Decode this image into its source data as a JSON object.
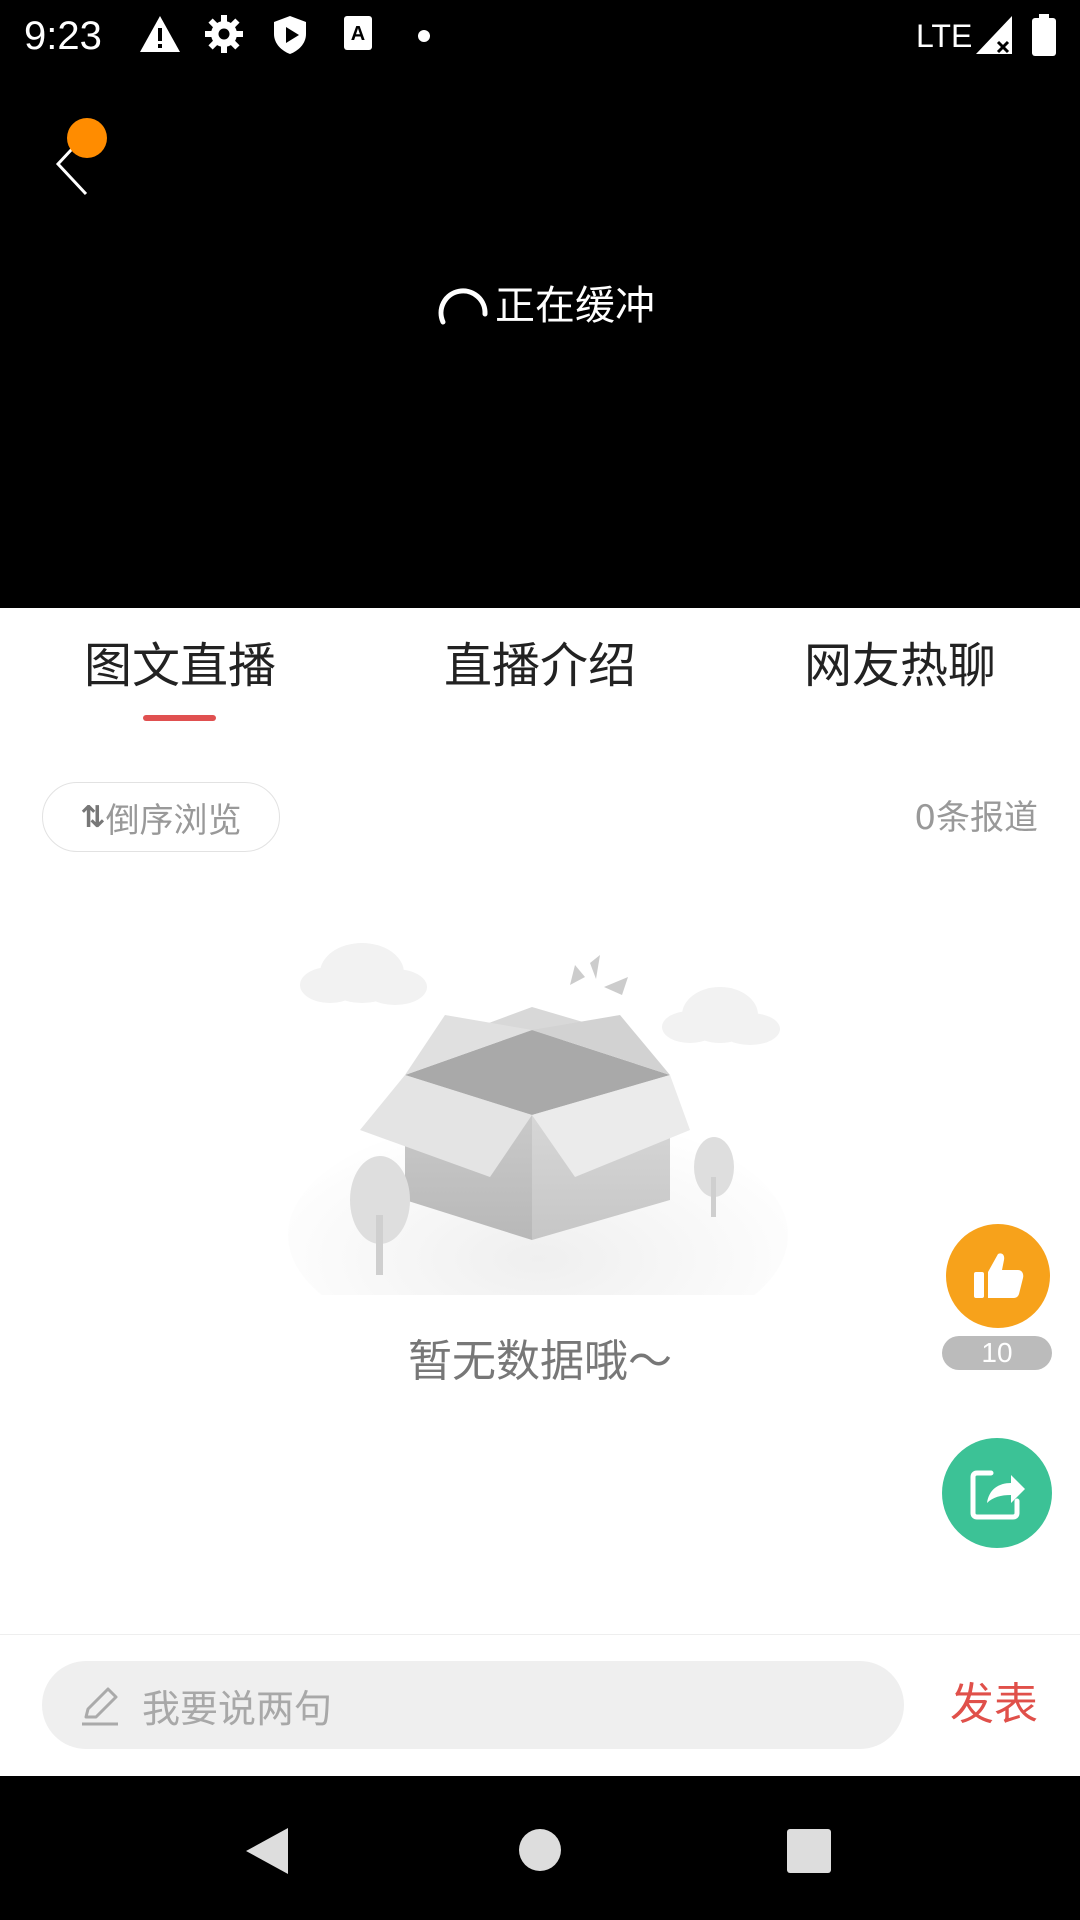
{
  "status_bar": {
    "time": "9:23",
    "network": "LTE",
    "icons": [
      "warning-icon",
      "settings-icon",
      "shield-play-icon",
      "a11y-icon",
      "dot-icon",
      "signal-icon",
      "battery-icon"
    ]
  },
  "player": {
    "buffering_text": "正在缓冲",
    "notification_dot_color": "#ff8c00"
  },
  "tabs": [
    {
      "label": "图文直播",
      "active": true
    },
    {
      "label": "直播介绍",
      "active": false
    },
    {
      "label": "网友热聊",
      "active": false
    }
  ],
  "feed": {
    "sort_label": "倒序浏览",
    "report_count": "0条报道",
    "empty_text": "暂无数据哦～"
  },
  "floating": {
    "like_count": "10",
    "like_color": "#f7a21b",
    "share_color": "#3cc296"
  },
  "comment_bar": {
    "placeholder": "我要说两句",
    "publish_label": "发表",
    "accent": "#e0504a"
  }
}
